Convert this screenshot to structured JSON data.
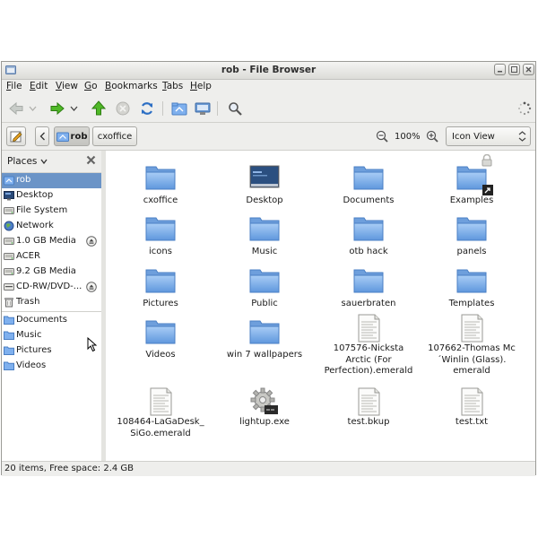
{
  "window": {
    "title": "rob - File Browser"
  },
  "menu": [
    {
      "u": "F",
      "rest": "ile"
    },
    {
      "u": "E",
      "rest": "dit"
    },
    {
      "u": "V",
      "rest": "iew"
    },
    {
      "u": "G",
      "rest": "o"
    },
    {
      "u": "B",
      "rest": "ookmarks"
    },
    {
      "u": "T",
      "rest": "abs"
    },
    {
      "u": "H",
      "rest": "elp"
    }
  ],
  "location": {
    "crumb_home": "rob",
    "crumb_current": "cxoffice",
    "zoom": "100%",
    "view_mode": "Icon View"
  },
  "sidebar": {
    "header": "Places",
    "items": [
      {
        "label": "rob",
        "icon": "home-folder-icon"
      },
      {
        "label": "Desktop",
        "icon": "desktop-icon"
      },
      {
        "label": "File System",
        "icon": "drive-icon"
      },
      {
        "label": "Network",
        "icon": "network-icon"
      },
      {
        "label": "1.0 GB Media",
        "icon": "drive-icon"
      },
      {
        "label": "ACER",
        "icon": "drive-icon"
      },
      {
        "label": "9.2 GB Media",
        "icon": "drive-icon"
      },
      {
        "label": "CD-RW/DVD-...",
        "icon": "optical-drive-icon"
      },
      {
        "label": "Trash",
        "icon": "trash-icon"
      },
      {
        "label": "Documents",
        "icon": "folder-icon"
      },
      {
        "label": "Music",
        "icon": "folder-icon"
      },
      {
        "label": "Pictures",
        "icon": "folder-icon"
      },
      {
        "label": "Videos",
        "icon": "folder-icon"
      }
    ]
  },
  "files": [
    {
      "name": "cxoffice",
      "type": "folder"
    },
    {
      "name": "Desktop",
      "type": "desktop"
    },
    {
      "name": "Documents",
      "type": "folder"
    },
    {
      "name": "Examples",
      "type": "folder-link-locked"
    },
    {
      "name": "icons",
      "type": "folder"
    },
    {
      "name": "Music",
      "type": "folder"
    },
    {
      "name": "otb hack",
      "type": "folder"
    },
    {
      "name": "panels",
      "type": "folder"
    },
    {
      "name": "Pictures",
      "type": "folder"
    },
    {
      "name": "Public",
      "type": "folder"
    },
    {
      "name": "sauerbraten",
      "type": "folder"
    },
    {
      "name": "Templates",
      "type": "folder"
    },
    {
      "name": "Videos",
      "type": "folder"
    },
    {
      "name": "win 7 wallpapers",
      "type": "folder"
    },
    {
      "name": "107576-Nicksta Arctic (For Perfection).emerald",
      "type": "text"
    },
    {
      "name": "107662-Thomas Mc´Winlin (Glass). emerald",
      "type": "text"
    },
    {
      "name": "108464-LaGaDesk_ SiGo.emerald",
      "type": "text"
    },
    {
      "name": "lightup.exe",
      "type": "executable"
    },
    {
      "name": "test.bkup",
      "type": "text"
    },
    {
      "name": "test.txt",
      "type": "text"
    }
  ],
  "status": "20 items, Free space: 2.4 GB",
  "colors": {
    "selection": "#6b94c7",
    "folder": "#7fb0ee"
  }
}
